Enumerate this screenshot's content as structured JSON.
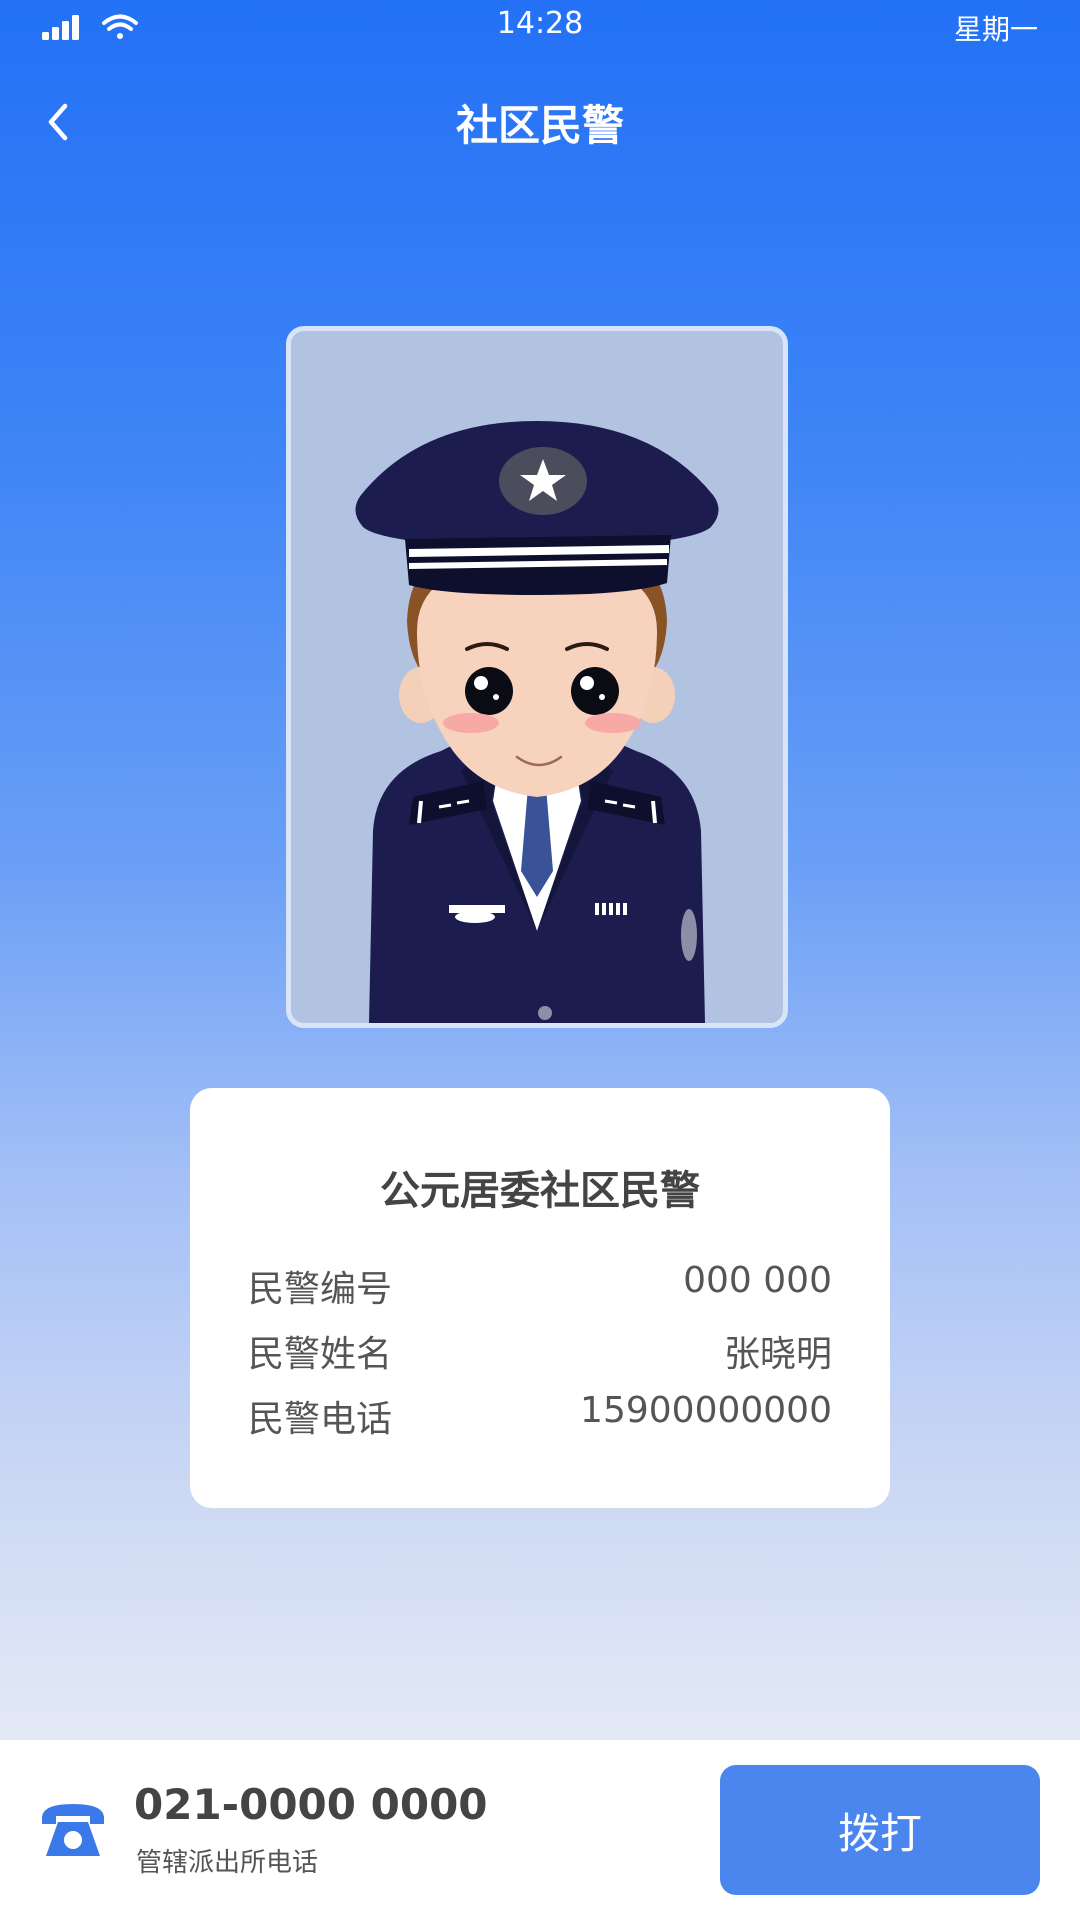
{
  "status_bar": {
    "time": "14:28",
    "day": "星期一"
  },
  "header": {
    "title": "社区民警"
  },
  "card": {
    "title": "公元居委社区民警",
    "rows": [
      {
        "label": "民警编号",
        "value": "000 000"
      },
      {
        "label": "民警姓名",
        "value": "张晓明"
      },
      {
        "label": "民警电话",
        "value": "15900000000"
      }
    ]
  },
  "footer": {
    "phone": "021-0000 0000",
    "phone_label": "管辖派出所电话",
    "call_label": "拨打"
  },
  "colors": {
    "primary": "#2371f6",
    "button": "#4a86ee",
    "uniform": "#1c1d4e"
  },
  "icons": [
    "signal-icon",
    "wifi-icon",
    "back-arrow-icon",
    "telephone-icon"
  ]
}
